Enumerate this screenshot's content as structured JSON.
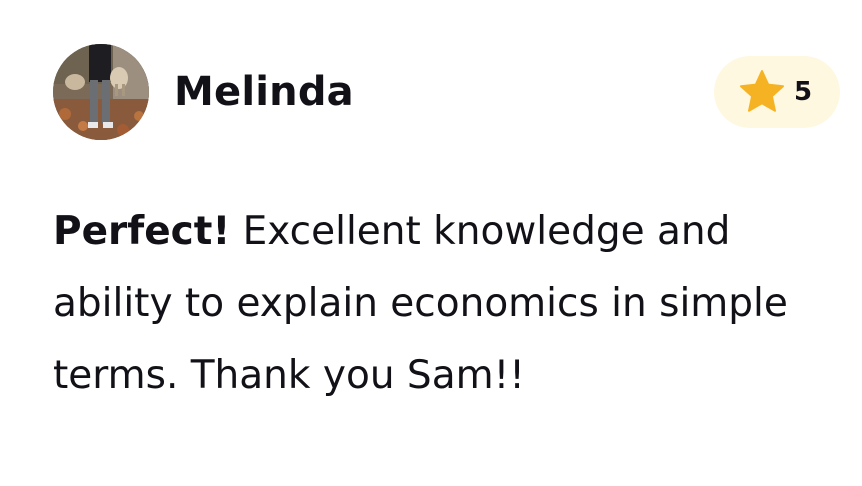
{
  "review": {
    "reviewer_name": "Melinda",
    "rating_value": "5",
    "rating_icon": "star-icon",
    "rating_color": "#f5b324",
    "badge_background": "#fff8e0",
    "headline": "Perfect!",
    "body": " Excellent knowledge and ability to explain economics in simple terms. Thank you Sam!!"
  }
}
